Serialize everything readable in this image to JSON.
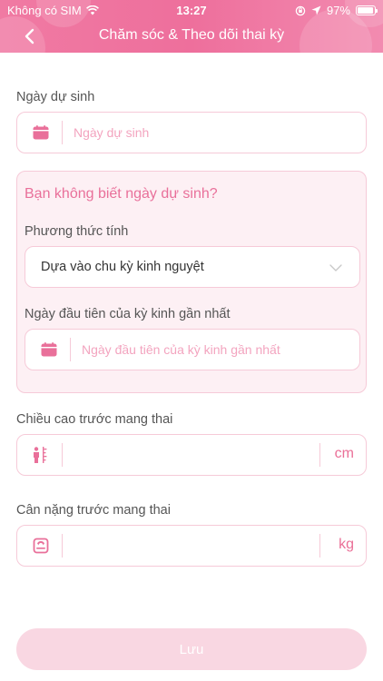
{
  "status_bar": {
    "carrier": "Không có SIM",
    "time": "13:27",
    "battery": "97%",
    "battery_level": 0.97
  },
  "nav": {
    "title": "Chăm sóc & Theo dõi thai kỳ"
  },
  "due_date": {
    "label": "Ngày dự sinh",
    "placeholder": "Ngày dự sinh"
  },
  "unknown_due_date": {
    "title": "Bạn không biết ngày dự sinh?",
    "method_label": "Phương thức tính",
    "method_value": "Dựa vào chu kỳ kinh nguyệt",
    "last_period_label": "Ngày đầu tiên của kỳ kinh gần nhất",
    "last_period_placeholder": "Ngày đầu tiên của kỳ kinh gần nhất"
  },
  "height": {
    "label": "Chiều cao trước mang thai",
    "unit": "cm"
  },
  "weight": {
    "label": "Cân nặng trước mang thai",
    "unit": "kg"
  },
  "save_button": "Lưu",
  "colors": {
    "accent": "#ee6f9c",
    "border": "#f6cad8",
    "box_bg": "#fdf0f4",
    "button_disabled": "#f9d7e2"
  }
}
